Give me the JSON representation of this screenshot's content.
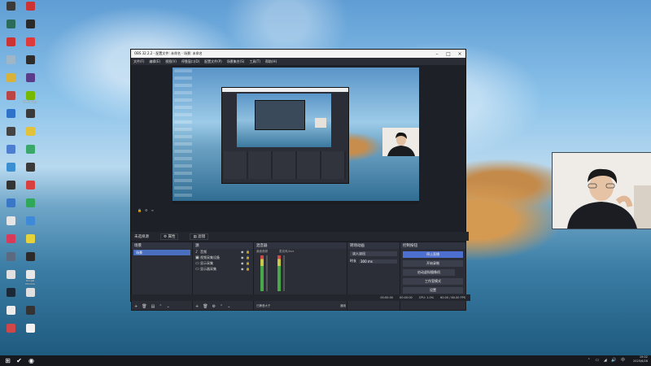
{
  "desktop": {
    "icons": [
      {
        "label": "",
        "icon": "app-icon",
        "color": "#3a3a3a"
      },
      {
        "label": "",
        "icon": "app-icon",
        "color": "#2b6b5a"
      },
      {
        "label": "",
        "icon": "app-icon",
        "color": "#c33"
      },
      {
        "label": "",
        "icon": "recycle-bin-icon",
        "color": "#9fb6c9"
      },
      {
        "label": "",
        "icon": "app-icon",
        "color": "#d8b23a"
      },
      {
        "label": "",
        "icon": "app-icon",
        "color": "#bb4444"
      },
      {
        "label": "",
        "icon": "app-icon",
        "color": "#2f72c9"
      },
      {
        "label": "",
        "icon": "app-icon",
        "color": "#444"
      },
      {
        "label": "",
        "icon": "app-icon",
        "color": "#4d7ecf"
      },
      {
        "label": "",
        "icon": "app-icon",
        "color": "#3b8fd1"
      },
      {
        "label": "",
        "icon": "app-icon",
        "color": "#333"
      },
      {
        "label": "",
        "icon": "app-icon",
        "color": "#3a78c7"
      },
      {
        "label": "",
        "icon": "app-icon",
        "color": "#e5e5e5"
      },
      {
        "label": "",
        "icon": "app-icon",
        "color": "#d83b5a"
      },
      {
        "label": "",
        "icon": "app-icon",
        "color": "#5a6a80"
      },
      {
        "label": "",
        "icon": "app-icon",
        "color": "#e0e0e0"
      },
      {
        "label": "",
        "icon": "steam-icon",
        "color": "#1b2838"
      },
      {
        "label": "",
        "icon": "app-icon",
        "color": "#ececec"
      },
      {
        "label": "",
        "icon": "app-icon",
        "color": "#d14646"
      },
      {
        "label": "",
        "icon": "app-icon",
        "color": "#cc3333"
      },
      {
        "label": "",
        "icon": "app-icon",
        "color": "#2a2a2a"
      },
      {
        "label": "",
        "icon": "app-icon",
        "color": "#e03b3b"
      },
      {
        "label": "",
        "icon": "app-icon",
        "color": "#2d2d2d"
      },
      {
        "label": "",
        "icon": "app-icon",
        "color": "#5a3d8a"
      },
      {
        "label": "NVIDIA App",
        "icon": "nvidia-icon",
        "color": "#76b900"
      },
      {
        "label": "",
        "icon": "app-icon",
        "color": "#3a3a3a"
      },
      {
        "label": "",
        "icon": "app-icon",
        "color": "#e2c23a"
      },
      {
        "label": "",
        "icon": "app-icon",
        "color": "#3aa86a"
      },
      {
        "label": "",
        "icon": "app-icon",
        "color": "#3a3a3a"
      },
      {
        "label": "",
        "icon": "app-icon",
        "color": "#d84040"
      },
      {
        "label": "",
        "icon": "app-icon",
        "color": "#2fa85a"
      },
      {
        "label": "",
        "icon": "app-icon",
        "color": "#3f8ad8"
      },
      {
        "label": "",
        "icon": "app-icon",
        "color": "#e6d23a"
      },
      {
        "label": "",
        "icon": "app-icon",
        "color": "#2b2b2b"
      },
      {
        "label": "Google Chrome",
        "icon": "chrome-icon",
        "color": "#e8e8e8"
      },
      {
        "label": "",
        "icon": "app-icon",
        "color": "#e0e0e0"
      },
      {
        "label": "",
        "icon": "app-icon",
        "color": "#333"
      },
      {
        "label": "",
        "icon": "file-icon",
        "color": "#f2f2f2"
      }
    ]
  },
  "obs": {
    "title": "OBS 32.2.2 - 配置文件: 未命名 - 场景: 未命名",
    "menu": [
      "文件(F)",
      "编辑(E)",
      "视图(V)",
      "停靠窗口(D)",
      "配置文件(P)",
      "场景集合(S)",
      "工具(T)",
      "帮助(H)"
    ],
    "ctrl_row": [
      "🔒",
      "⚙",
      "≡"
    ],
    "scene_bar": {
      "name": "未选择源",
      "props": "属性",
      "filters": "滤镜"
    },
    "docks": {
      "scenes": {
        "title": "场景",
        "items": [
          "场景"
        ]
      },
      "sources": {
        "title": "源",
        "items": [
          {
            "name": "音频",
            "icon": "speaker-icon"
          },
          {
            "name": "视频采集设备",
            "icon": "camera-icon"
          },
          {
            "name": "显示采集",
            "icon": "monitor-icon"
          },
          {
            "name": "显示器采集",
            "icon": "monitor-icon"
          }
        ]
      },
      "mixer": {
        "title": "混音器",
        "channels": [
          {
            "name": "桌面音频"
          },
          {
            "name": "麦克风/Aux"
          }
        ],
        "footer": "已静音大于",
        "footer_menu": "通用"
      },
      "transitions": {
        "title": "转场动画",
        "type": "淡入淡出",
        "duration_label": "时长",
        "duration": "300 ms"
      },
      "controls": {
        "title": "控制按钮",
        "buttons": [
          "停止直播",
          "开始录制",
          "启动虚拟摄像机",
          "工作室模式",
          "设置"
        ]
      }
    },
    "status": {
      "live": "00:00:00",
      "rec": "00:00:00",
      "cpu": "CPU: 1.0%",
      "fps": "60.00 / 60.00 FPS"
    }
  },
  "taskbar": {
    "time": "19:02",
    "date": "2025/6/28"
  }
}
